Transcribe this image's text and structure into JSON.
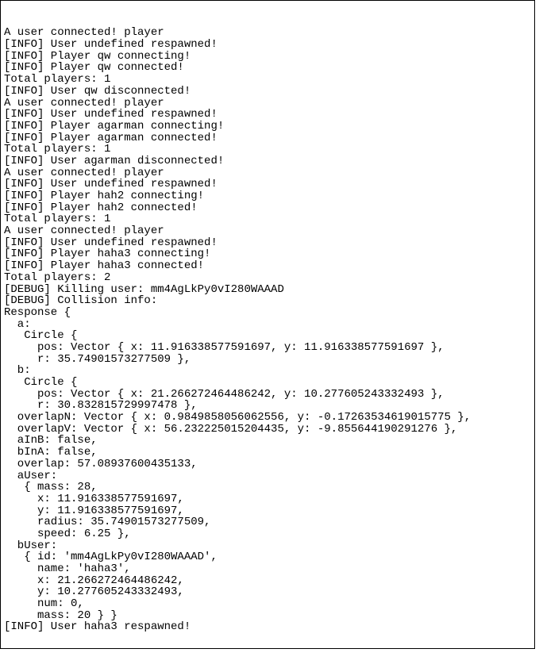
{
  "log_lines": [
    "A user connected! player",
    "[INFO] User undefined respawned!",
    "[INFO] Player qw connecting!",
    "[INFO] Player qw connected!",
    "Total players: 1",
    "[INFO] User qw disconnected!",
    "A user connected! player",
    "[INFO] User undefined respawned!",
    "[INFO] Player agarman connecting!",
    "[INFO] Player agarman connected!",
    "Total players: 1",
    "[INFO] User agarman disconnected!",
    "A user connected! player",
    "[INFO] User undefined respawned!",
    "[INFO] Player hah2 connecting!",
    "[INFO] Player hah2 connected!",
    "Total players: 1",
    "A user connected! player",
    "[INFO] User undefined respawned!",
    "[INFO] Player haha3 connecting!",
    "[INFO] Player haha3 connected!",
    "Total players: 2",
    "[DEBUG] Killing user: mm4AgLkPy0vI280WAAAD",
    "[DEBUG] Collision info:",
    "Response {",
    "  a:",
    "   Circle {",
    "     pos: Vector { x: 11.916338577591697, y: 11.916338577591697 },",
    "     r: 35.74901573277509 },",
    "  b:",
    "   Circle {",
    "     pos: Vector { x: 21.266272464486242, y: 10.277605243332493 },",
    "     r: 30.832815729997478 },",
    "  overlapN: Vector { x: 0.9849858056062556, y: -0.17263534619015775 },",
    "  overlapV: Vector { x: 56.232225015204435, y: -9.855644190291276 },",
    "  aInB: false,",
    "  bInA: false,",
    "  overlap: 57.08937600435133,",
    "  aUser:",
    "   { mass: 28,",
    "     x: 11.916338577591697,",
    "     y: 11.916338577591697,",
    "     radius: 35.74901573277509,",
    "     speed: 6.25 },",
    "  bUser:",
    "   { id: 'mm4AgLkPy0vI280WAAAD',",
    "     name: 'haha3',",
    "     x: 21.266272464486242,",
    "     y: 10.277605243332493,",
    "     num: 0,",
    "     mass: 20 } }",
    "[INFO] User haha3 respawned!"
  ]
}
